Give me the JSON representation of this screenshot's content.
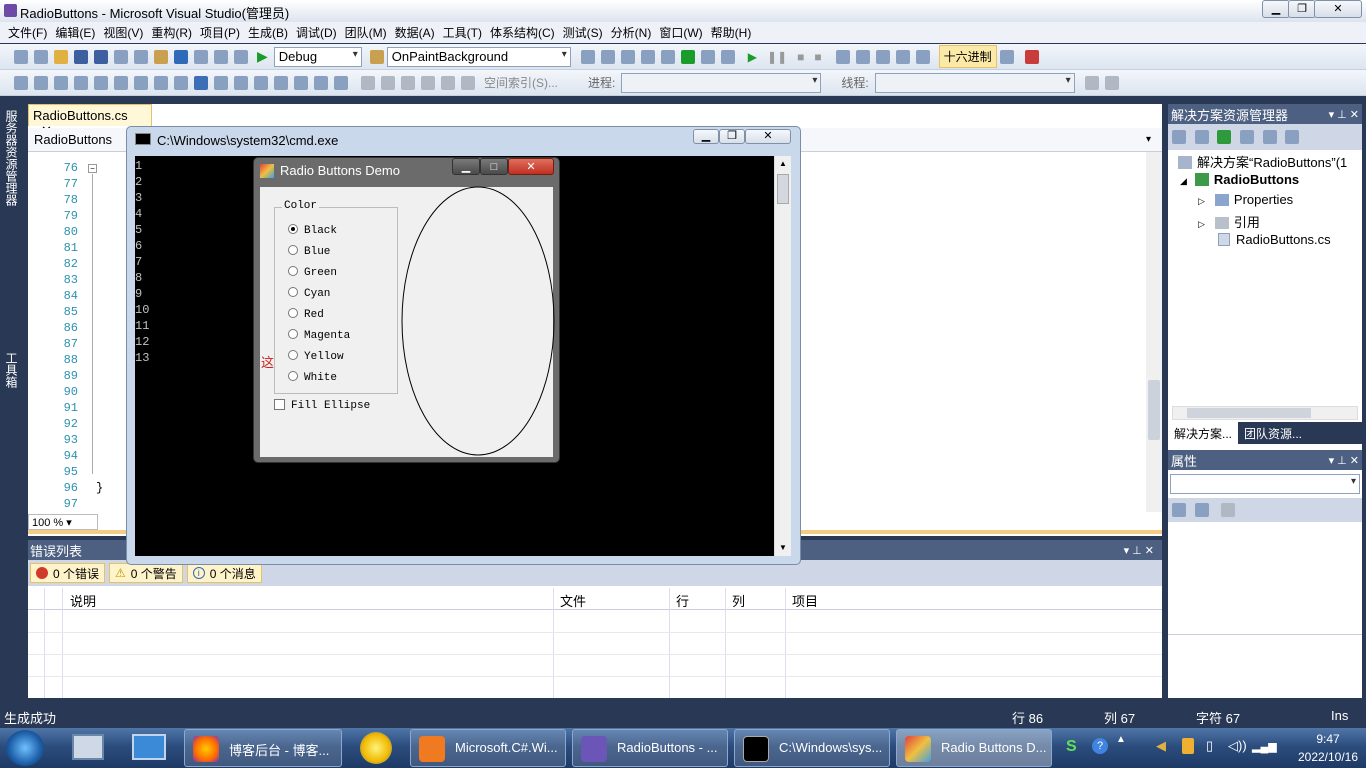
{
  "window": {
    "title": "RadioButtons - Microsoft Visual Studio(管理员)"
  },
  "menu": [
    "文件(F)",
    "编辑(E)",
    "视图(V)",
    "重构(R)",
    "项目(P)",
    "生成(B)",
    "调试(D)",
    "团队(M)",
    "数据(A)",
    "工具(T)",
    "体系结构(C)",
    "测试(S)",
    "分析(N)",
    "窗口(W)",
    "帮助(H)"
  ],
  "toolbar": {
    "config": "Debug",
    "target": "OnPaintBackground",
    "hex_label": "十六进制",
    "index_label": "空间索引(S)...",
    "process_label": "进程:",
    "thread_label": "线程:"
  },
  "sidetabs": {
    "server_explorer": "服务器资源管理器",
    "toolbox": "工具箱"
  },
  "editor": {
    "tab_label": "RadioButtons.cs",
    "nav_label": "RadioButtons",
    "line_numbers": [
      "76",
      "77",
      "78",
      "79",
      "80",
      "81",
      "82",
      "83",
      "84",
      "85",
      "86",
      "87",
      "88",
      "89",
      "90",
      "91",
      "92",
      "93",
      "94",
      "95",
      "96",
      "97"
    ],
    "closing_brace": "}",
    "zoom": "100 %"
  },
  "cmd": {
    "title": "C:\\Windows\\system32\\cmd.exe",
    "output": "1\n2\n3\n4\n5\n6\n7\n8\n9\n10\n11\n12\n13"
  },
  "form": {
    "title": "Radio Buttons Demo",
    "group_label": "Color",
    "options": [
      "Black",
      "Blue",
      "Green",
      "Cyan",
      "Red",
      "Magenta",
      "Yellow",
      "White"
    ],
    "selected": "Black",
    "checkbox_label": "Fill Ellipse",
    "checkbox_checked": false,
    "partial_text": "这"
  },
  "errorlist": {
    "title": "错误列表",
    "errors": "0 个错误",
    "warnings": "0 个警告",
    "messages": "0 个消息",
    "columns": [
      "说明",
      "文件",
      "行",
      "列",
      "项目"
    ]
  },
  "solution_explorer": {
    "title": "解决方案资源管理器",
    "root": "解决方案“RadioButtons”(1",
    "project": "RadioButtons",
    "items": [
      "Properties",
      "引用",
      "RadioButtons.cs"
    ],
    "bottom_tabs": [
      "解决方案...",
      "团队资源..."
    ]
  },
  "properties": {
    "title": "属性"
  },
  "status": {
    "message": "生成成功",
    "line": "行 86",
    "col": "列 67",
    "char": "字符 67",
    "mode": "Ins"
  },
  "taskbar": {
    "items": [
      "博客后台 - 博客...",
      "Microsoft.C#.Wi...",
      "RadioButtons - ...",
      "C:\\Windows\\sys...",
      "Radio Buttons D..."
    ],
    "time": "9:47",
    "date": "2022/10/16"
  }
}
